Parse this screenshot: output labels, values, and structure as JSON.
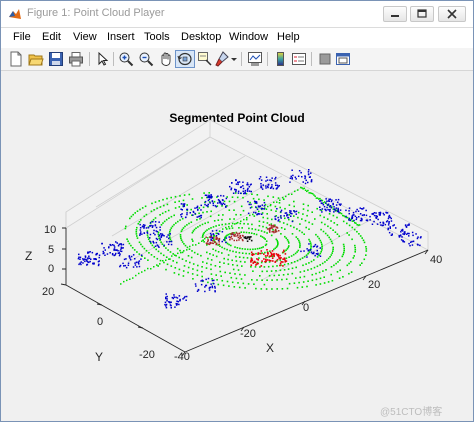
{
  "window": {
    "title": "Figure 1: Point Cloud Player"
  },
  "menu": [
    "File",
    "Edit",
    "View",
    "Insert",
    "Tools",
    "Desktop",
    "Window",
    "Help"
  ],
  "toolbar_icons": [
    "new-figure-icon",
    "open-file-icon",
    "save-icon",
    "print-icon",
    "pointer-icon",
    "zoom-in-icon",
    "zoom-out-icon",
    "pan-icon",
    "rotate-3d-icon",
    "data-cursor-icon",
    "brush-icon",
    "brush-dropdown-icon",
    "link-plot-icon",
    "colorbar-icon",
    "legend-icon",
    "hide-plot-tools-icon",
    "show-plot-tools-icon"
  ],
  "plot": {
    "title": "Segmented Point Cloud",
    "xlabel": "X",
    "ylabel": "Y",
    "zlabel": "Z",
    "x_ticks": [
      "-40",
      "-20",
      "0",
      "20",
      "40"
    ],
    "y_ticks": [
      "-20",
      "0",
      "20"
    ],
    "z_ticks": [
      "0",
      "5",
      "10"
    ],
    "colors": {
      "ground": "#00dd00",
      "obstacles": "#0000cc",
      "ego_vehicle": "#e8000a",
      "nearby": "#a82828"
    }
  },
  "watermark": "@51CTO博客"
}
